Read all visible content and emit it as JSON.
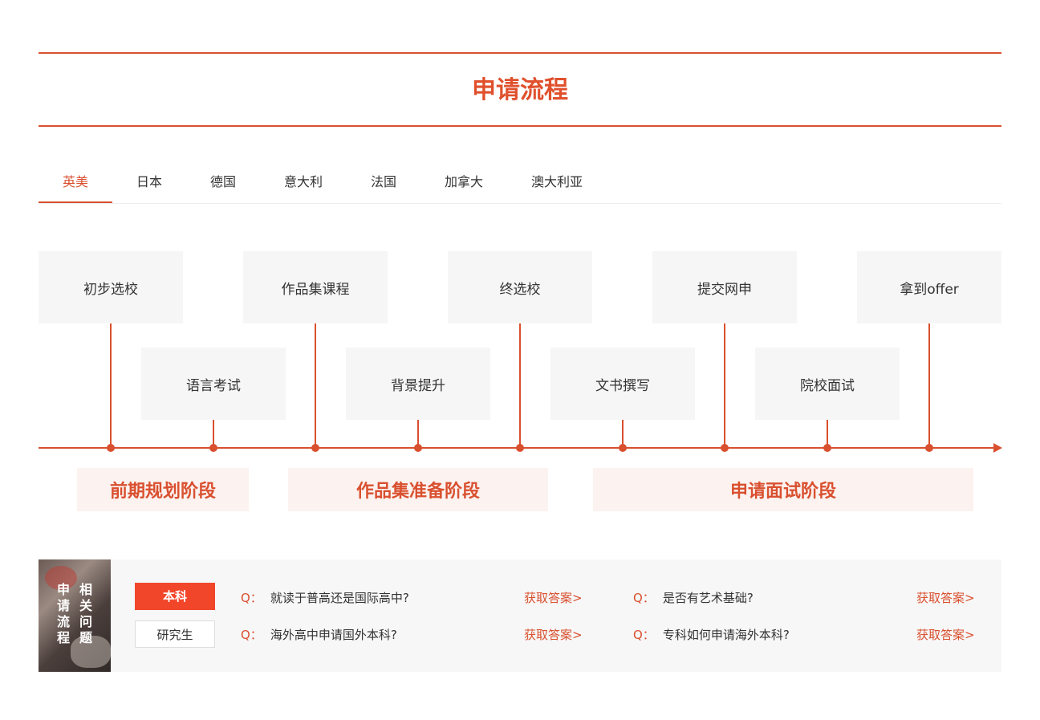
{
  "header": {
    "title": "申请流程"
  },
  "tabs": [
    "英美",
    "日本",
    "德国",
    "意大利",
    "法国",
    "加拿大",
    "澳大利亚"
  ],
  "steps_top": [
    "初步选校",
    "作品集课程",
    "终选校",
    "提交网申",
    "拿到offer"
  ],
  "steps_bottom": [
    "语言考试",
    "背景提升",
    "文书撰写",
    "院校面试"
  ],
  "stages": [
    "前期规划阶段",
    "作品集准备阶段",
    "申请面试阶段"
  ],
  "faq": {
    "side_title_left": "申请流程",
    "side_title_right": "相关问题",
    "categories": [
      "本科",
      "研究生"
    ],
    "q_prefix": "Q：",
    "answer_label": "获取答案>",
    "questions": [
      "就读于普高还是国际高中?",
      "是否有艺术基础?",
      "海外高中申请国外本科?",
      "专科如何申请海外本科?"
    ]
  },
  "colors": {
    "accent": "#d9502f",
    "accent_bright": "#f2462a",
    "box_bg": "#f6f6f6",
    "stage_bg": "#fcf2ef"
  }
}
